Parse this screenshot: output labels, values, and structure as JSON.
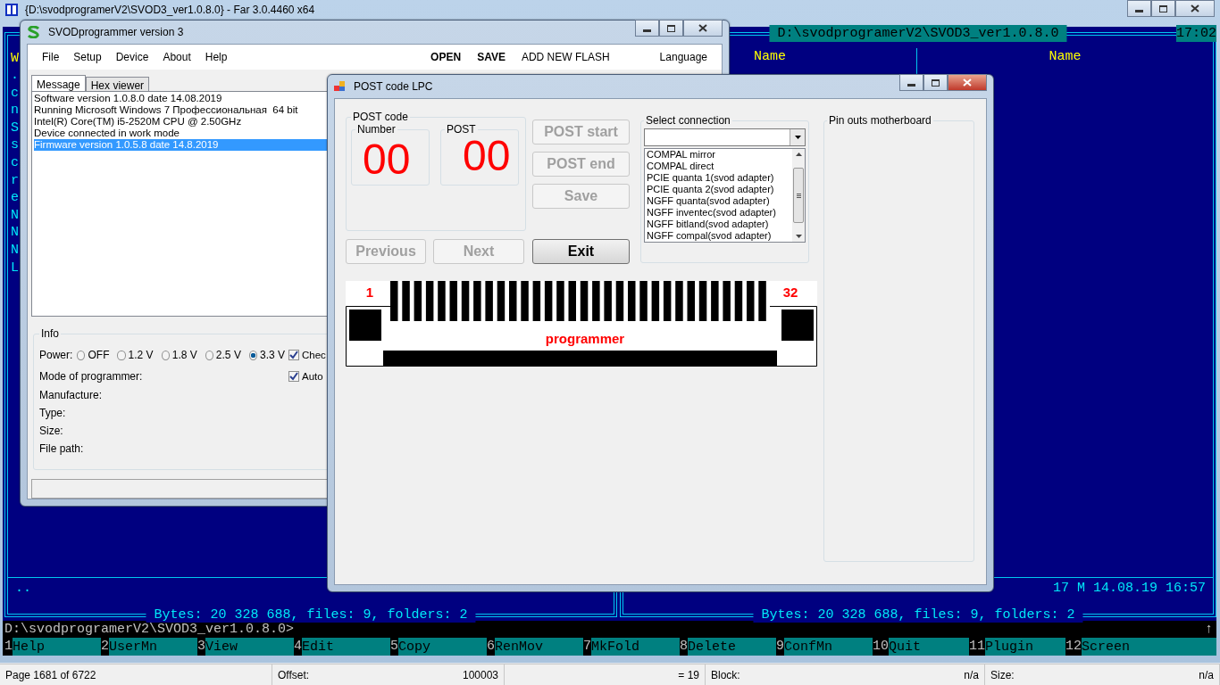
{
  "far_window": {
    "title": "{D:\\svodprogramerV2\\SVOD3_ver1.0.8.0} - Far 3.0.4460 x64",
    "left_panel": {
      "header_fragment": "W",
      "fragments": [
        ".",
        "c",
        "n",
        "S",
        "s",
        "c",
        "r",
        "e",
        "N",
        "N",
        "N",
        "L"
      ],
      "parent_entry": "..",
      "summary": "Bytes: 20 328 688, files: 9, folders: 2"
    },
    "right_panel": {
      "path": "D:\\svodprogramerV2\\SVOD3_ver1.0.8.0",
      "clock": "17:02",
      "column_headers": [
        "Name",
        "Name"
      ],
      "file_info": "17 M 14.08.19 16:57",
      "summary": "Bytes: 20 328 688, files: 9, folders: 2"
    },
    "command_line": "D:\\svodprogramerV2\\SVOD3_ver1.0.8.0>",
    "scroll_arrow": "↑",
    "keybar": [
      {
        "number": "1",
        "label": "Help"
      },
      {
        "number": "2",
        "label": "UserMn"
      },
      {
        "number": "3",
        "label": "View"
      },
      {
        "number": "4",
        "label": "Edit"
      },
      {
        "number": "5",
        "label": "Copy"
      },
      {
        "number": "6",
        "label": "RenMov"
      },
      {
        "number": "7",
        "label": "MkFold"
      },
      {
        "number": "8",
        "label": "Delete"
      },
      {
        "number": "9",
        "label": "ConfMn"
      },
      {
        "number": "10",
        "label": "Quit"
      },
      {
        "number": "11",
        "label": "Plugin"
      },
      {
        "number": "12",
        "label": "Screen"
      }
    ]
  },
  "svod_window": {
    "title": "SVODprogrammer version 3",
    "menu": [
      "File",
      "Setup",
      "Device",
      "About",
      "Help"
    ],
    "actions": [
      "OPEN",
      "SAVE"
    ],
    "add_flash": "ADD NEW FLASH",
    "language": "Language",
    "tabs": [
      {
        "label": "Message",
        "selected": true
      },
      {
        "label": "Hex viewer",
        "selected": false
      }
    ],
    "messages": [
      {
        "text": "Software version 1.0.8.0 date 14.08.2019",
        "selected": false
      },
      {
        "text": "Running Microsoft Windows 7 Профессиональная  64 bit",
        "selected": false
      },
      {
        "text": "Intel(R) Core(TM) i5-2520M CPU @ 2.50GHz",
        "selected": false
      },
      {
        "text": "Device connected in work mode",
        "selected": false
      },
      {
        "text": "Firmware version 1.0.5.8 date 14.8.2019",
        "selected": true
      }
    ],
    "info": {
      "title": "Info",
      "power_label": "Power:",
      "power_options": [
        {
          "label": "OFF",
          "selected": false
        },
        {
          "label": "1.2 V",
          "selected": false
        },
        {
          "label": "1.8 V",
          "selected": false
        },
        {
          "label": "2.5 V",
          "selected": false
        },
        {
          "label": "3.3 V",
          "selected": true
        }
      ],
      "check_options": [
        {
          "label": "Chec",
          "checked": true
        },
        {
          "label": "Auto",
          "checked": true
        }
      ],
      "fields": [
        "Mode of programmer:",
        "Manufacture:",
        "Type:",
        "Size:",
        "File path:"
      ]
    }
  },
  "post_dialog": {
    "title": "POST code LPC",
    "post_code": {
      "title": "POST code",
      "number_label": "Number",
      "number": "00",
      "post_label": "POST",
      "post": "00"
    },
    "buttons": [
      {
        "label": "POST start",
        "disabled": true
      },
      {
        "label": "POST end",
        "disabled": true
      },
      {
        "label": "Save",
        "disabled": true
      }
    ],
    "nav_buttons": [
      {
        "label": "Previous",
        "disabled": true
      },
      {
        "label": "Next",
        "disabled": true
      },
      {
        "label": "Exit",
        "disabled": false
      }
    ],
    "connection": {
      "title": "Select connection",
      "options": [
        "COMPAL mirror",
        "COMPAL direct",
        "PCIE quanta 1(svod adapter)",
        "PCIE quanta 2(svod adapter)",
        "NGFF quanta(svod adapter)",
        "NGFF inventec(svod adapter)",
        "NGFF bitland(svod adapter)",
        "NGFF compal(svod adapter)"
      ]
    },
    "pinout": {
      "title": "Pin outs motherboard"
    },
    "connector": {
      "first_pin": "1",
      "last_pin": "32",
      "label": "programmer"
    }
  },
  "status_bar": [
    {
      "label": "Page 1681 of 6722"
    },
    {
      "label": "Offset:",
      "value": "100003"
    },
    {
      "value": "= 19"
    },
    {
      "label": "Block:",
      "value": "n/a"
    },
    {
      "label": "Size:",
      "value": "n/a"
    }
  ]
}
